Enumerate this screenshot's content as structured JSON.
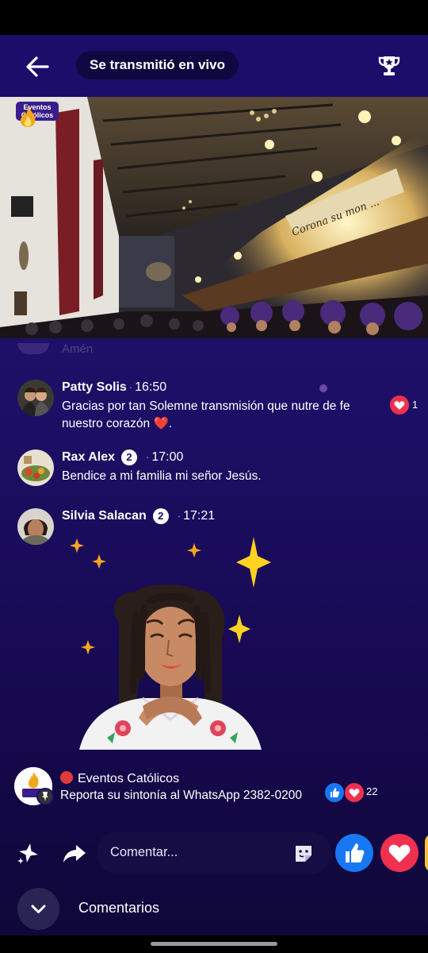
{
  "header": {
    "live_label": "Se transmitió en vivo",
    "back_icon": "arrow-left-icon",
    "trophy_icon": "trophy-icon"
  },
  "video": {
    "logo_text_line1": "Eventos",
    "logo_text_line2": "Católicos",
    "banner_text": "Corona su mon ...",
    "faded_comment": "Amén"
  },
  "comments": [
    {
      "name": "Patty Solis",
      "time": "16:50",
      "text": "Gracias por tan Solemne transmisión que nutre de fe nuestro corazón ❤️.",
      "reaction_count": "1",
      "reaction_icon": "heart-reaction-icon"
    },
    {
      "name": "Rax Alex",
      "badge": "2",
      "time": "17:00",
      "text": "Bendice a mi familia mi señor Jesús."
    },
    {
      "name": "Silvia Salacan",
      "badge": "2",
      "time": "17:21",
      "sticker": "avatar-sticker"
    }
  ],
  "pinned": {
    "title": "Eventos Católicos",
    "text": "Reporta su sintonía al WhatsApp 2382-0200",
    "reaction_count": "22"
  },
  "composer": {
    "placeholder": "Comentar..."
  },
  "footer": {
    "label": "Comentarios"
  },
  "colors": {
    "background": "#1d0f66",
    "like": "#1877f2",
    "love": "#f0304f"
  }
}
